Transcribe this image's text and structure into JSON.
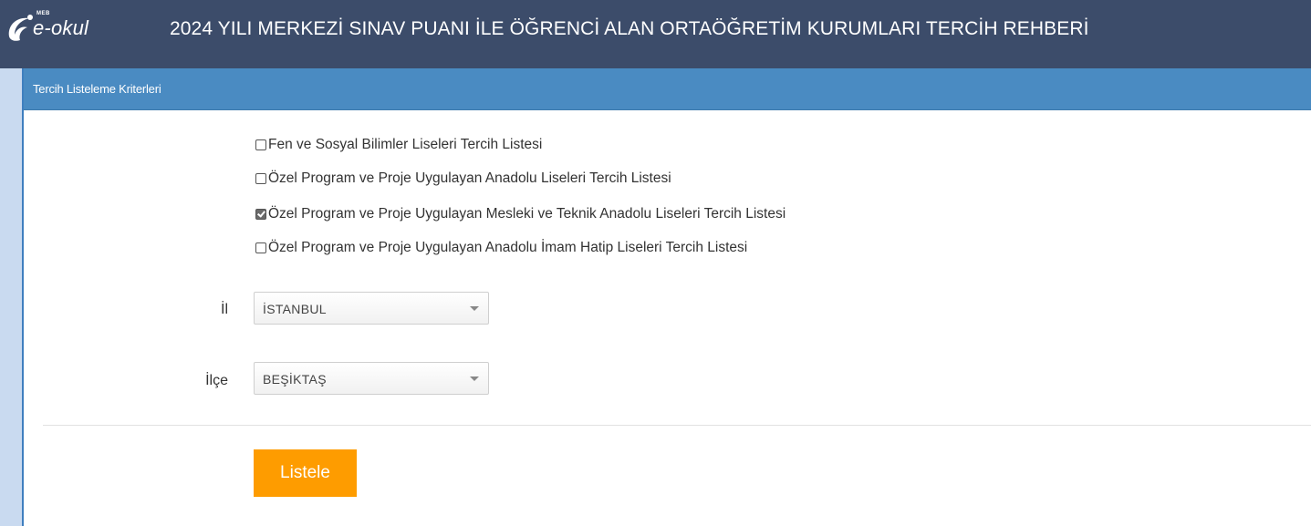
{
  "header": {
    "logo_meb": "MEB",
    "logo_text": "e-okul",
    "title": "2024 YILI MERKEZİ SINAV PUANI İLE ÖĞRENCİ ALAN ORTAÖĞRETİM KURUMLARI TERCİH REHBERİ"
  },
  "panel": {
    "title": "Tercih Listeleme Kriterleri"
  },
  "options": [
    {
      "label": "Fen ve Sosyal Bilimler Liseleri Tercih Listesi",
      "checked": false
    },
    {
      "label": "Özel Program ve Proje Uygulayan Anadolu Liseleri Tercih Listesi",
      "checked": false
    },
    {
      "label": "Özel Program ve Proje Uygulayan Mesleki ve Teknik Anadolu Liseleri Tercih Listesi",
      "checked": true
    },
    {
      "label": "Özel Program ve Proje Uygulayan Anadolu İmam Hatip Liseleri Tercih Listesi",
      "checked": false
    }
  ],
  "fields": {
    "il": {
      "label": "İl",
      "value": "İSTANBUL"
    },
    "ilce": {
      "label": "İlçe",
      "value": "BEŞİKTAŞ"
    }
  },
  "actions": {
    "submit_label": "Listele"
  },
  "colors": {
    "topbar": "#3c4c6a",
    "panel_header": "#4a8bc2",
    "button": "#fe9c00",
    "page_bg": "#c9daf0"
  }
}
